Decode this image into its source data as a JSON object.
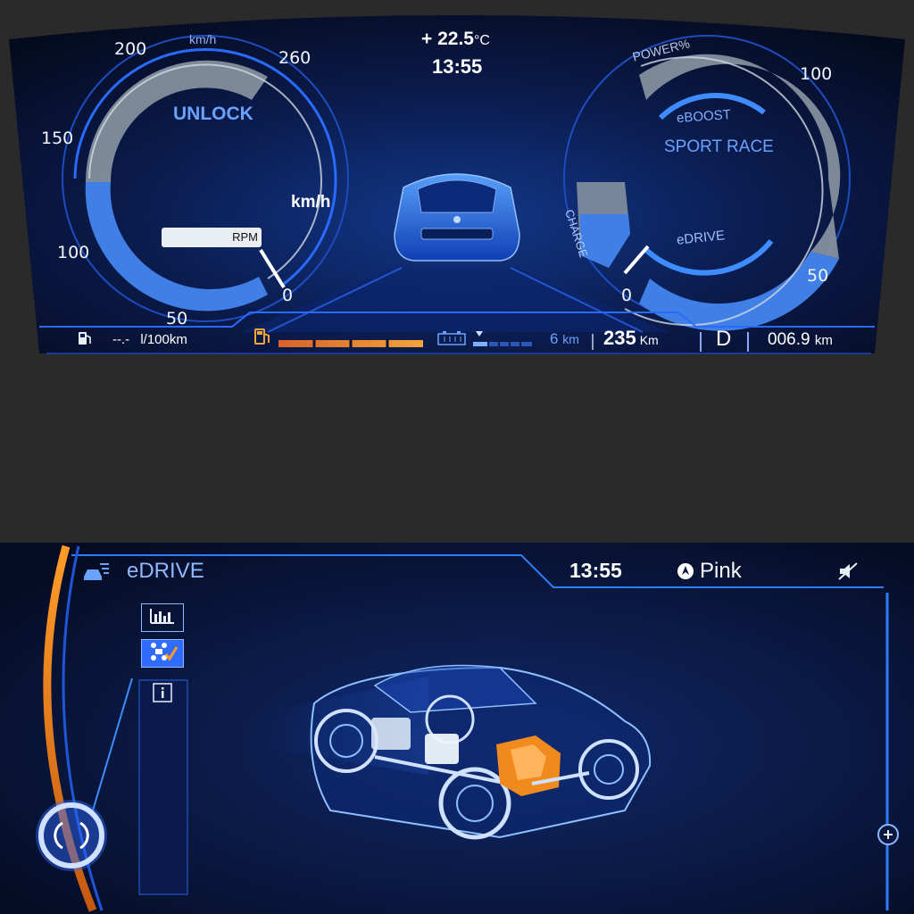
{
  "cluster": {
    "temperature": "+ 22.5",
    "temperature_unit": "°C",
    "clock": "13:55",
    "speed_unit_arc": "km/h",
    "speed_unit_label": "km/h",
    "lock_status": "UNLOCK",
    "rpm_label": "RPM",
    "speed_ticks": [
      "200",
      "260",
      "150",
      "100",
      "50",
      "0"
    ],
    "power_label": "POWER%",
    "power_ticks": [
      "100",
      "50",
      "0"
    ],
    "mode_eboost": "eBOOST",
    "mode_sport": "SPORT RACE",
    "mode_edrive": "eDRIVE",
    "charge_label": "CHARGE",
    "consumption_value": "--.-",
    "consumption_unit": "l/100km",
    "electric_range": "6",
    "electric_range_unit": "km",
    "total_range": "235",
    "total_range_unit": "Km",
    "gear": "D",
    "trip_distance": "006.9",
    "trip_unit": "km",
    "fuel_level_percent": 100,
    "battery_level_percent": 20
  },
  "idrive": {
    "title": "eDRIVE",
    "clock": "13:55",
    "nav_destination": "Pink",
    "menu": [
      {
        "icon": "bar-chart-icon"
      },
      {
        "icon": "drivetrain-check-icon"
      },
      {
        "icon": "info-icon"
      }
    ]
  },
  "colors": {
    "accent_blue": "#2f7dff",
    "accent_orange": "#ff8a1e",
    "background": "#2a2a2a"
  }
}
